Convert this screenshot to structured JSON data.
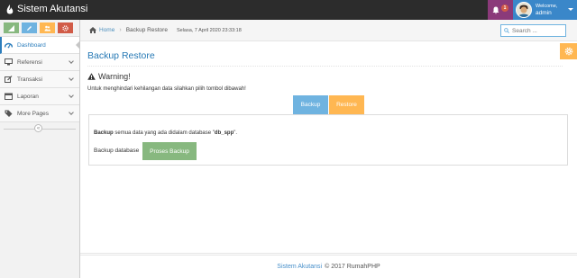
{
  "app": {
    "title": "Sistem Akutansi"
  },
  "colors": {
    "navbar": "#2c2c2c",
    "notif_bg": "#8b3a7a",
    "user_bg": "#3a87c9",
    "primary": "#6fb3e0",
    "warning": "#ffb752",
    "success": "#87b87f",
    "danger": "#d15b47",
    "link": "#2679b5"
  },
  "navbar": {
    "notification_count": "1",
    "user_greeting": "Welcome,",
    "user_name": "admin"
  },
  "sidebar": {
    "shortcuts": [
      {
        "icon": "signal-icon",
        "color": "green"
      },
      {
        "icon": "pencil-icon",
        "color": "blue"
      },
      {
        "icon": "users-icon",
        "color": "orange"
      },
      {
        "icon": "cogs-icon",
        "color": "red"
      }
    ],
    "items": [
      {
        "label": "Dashboard",
        "icon": "tachometer-icon",
        "active": true
      },
      {
        "label": "Referensi",
        "icon": "desktop-icon"
      },
      {
        "label": "Transaksi",
        "icon": "edit-icon"
      },
      {
        "label": "Laporan",
        "icon": "calendar-icon"
      },
      {
        "label": "More Pages",
        "icon": "tag-icon"
      }
    ],
    "collapse_glyph": "«"
  },
  "breadcrumbs": {
    "home": "Home",
    "separator": "›",
    "current": "Backup Restore",
    "datetime": "Selasa, 7 April 2020 23:33:18"
  },
  "search": {
    "placeholder": "Search ..."
  },
  "page": {
    "header": "Backup Restore",
    "warning_title": "Warning!",
    "warning_text": "Untuk menghindari kehilangan data silahkan pilih tombol dibawah!",
    "tabs": {
      "backup": "Backup",
      "restore": "Restore"
    },
    "panel": {
      "bold_word": "Backup",
      "line_text": " semua data yang ada didalam database \"",
      "db_name": "db_spp",
      "line_end": "\".",
      "label": "Backup database",
      "button": "Proses Backup"
    }
  },
  "footer": {
    "brand": "Sistem Akutansi",
    "text": "© 2017 RumahPHP"
  }
}
